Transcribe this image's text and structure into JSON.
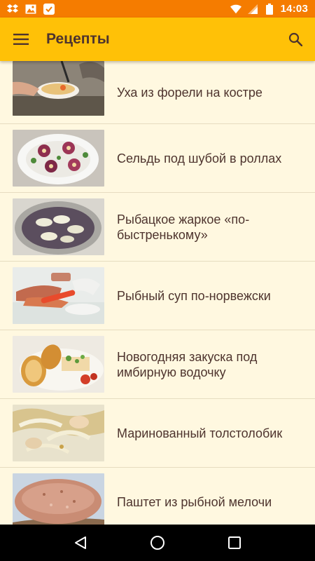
{
  "status_bar": {
    "time": "14:03",
    "left_icons": [
      "dropbox-icon",
      "image-icon",
      "check-icon"
    ],
    "right_icons": [
      "wifi-icon",
      "signal-icon",
      "battery-icon"
    ]
  },
  "app_bar": {
    "title": "Рецепты",
    "menu_icon": "menu-icon",
    "search_icon": "search-icon"
  },
  "recipes": [
    {
      "title": "Уха из форели на костре"
    },
    {
      "title": "Сельдь под шубой в роллах"
    },
    {
      "title": "Рыбацкое жаркое «по-быстренькому»"
    },
    {
      "title": "Рыбный суп по-норвежски"
    },
    {
      "title": "Новогодняя закуска под имбирную водочку"
    },
    {
      "title": "Маринованный толстолобик"
    },
    {
      "title": "Паштет из рыбной мелочи"
    }
  ],
  "colors": {
    "status_bar": "#F57C00",
    "app_bar": "#FFC107",
    "background": "#FFF8E0",
    "text": "#4E342E"
  }
}
